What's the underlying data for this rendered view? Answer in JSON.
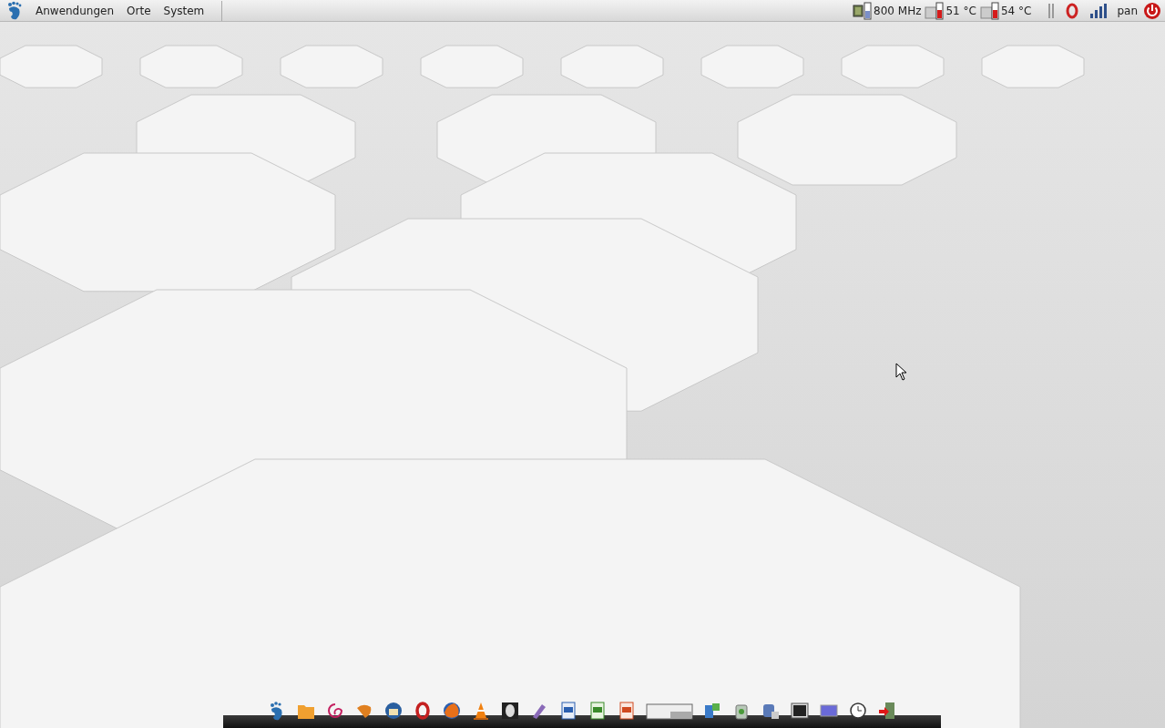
{
  "top_panel": {
    "menus": [
      {
        "label": "Anwendungen"
      },
      {
        "label": "Orte"
      },
      {
        "label": "System"
      }
    ],
    "indicators": [
      {
        "kind": "cpu",
        "text": "800 MHz"
      },
      {
        "kind": "temperature",
        "text": "51 °C"
      },
      {
        "kind": "temperature",
        "text": "54 °C"
      }
    ],
    "user": "pan"
  }
}
